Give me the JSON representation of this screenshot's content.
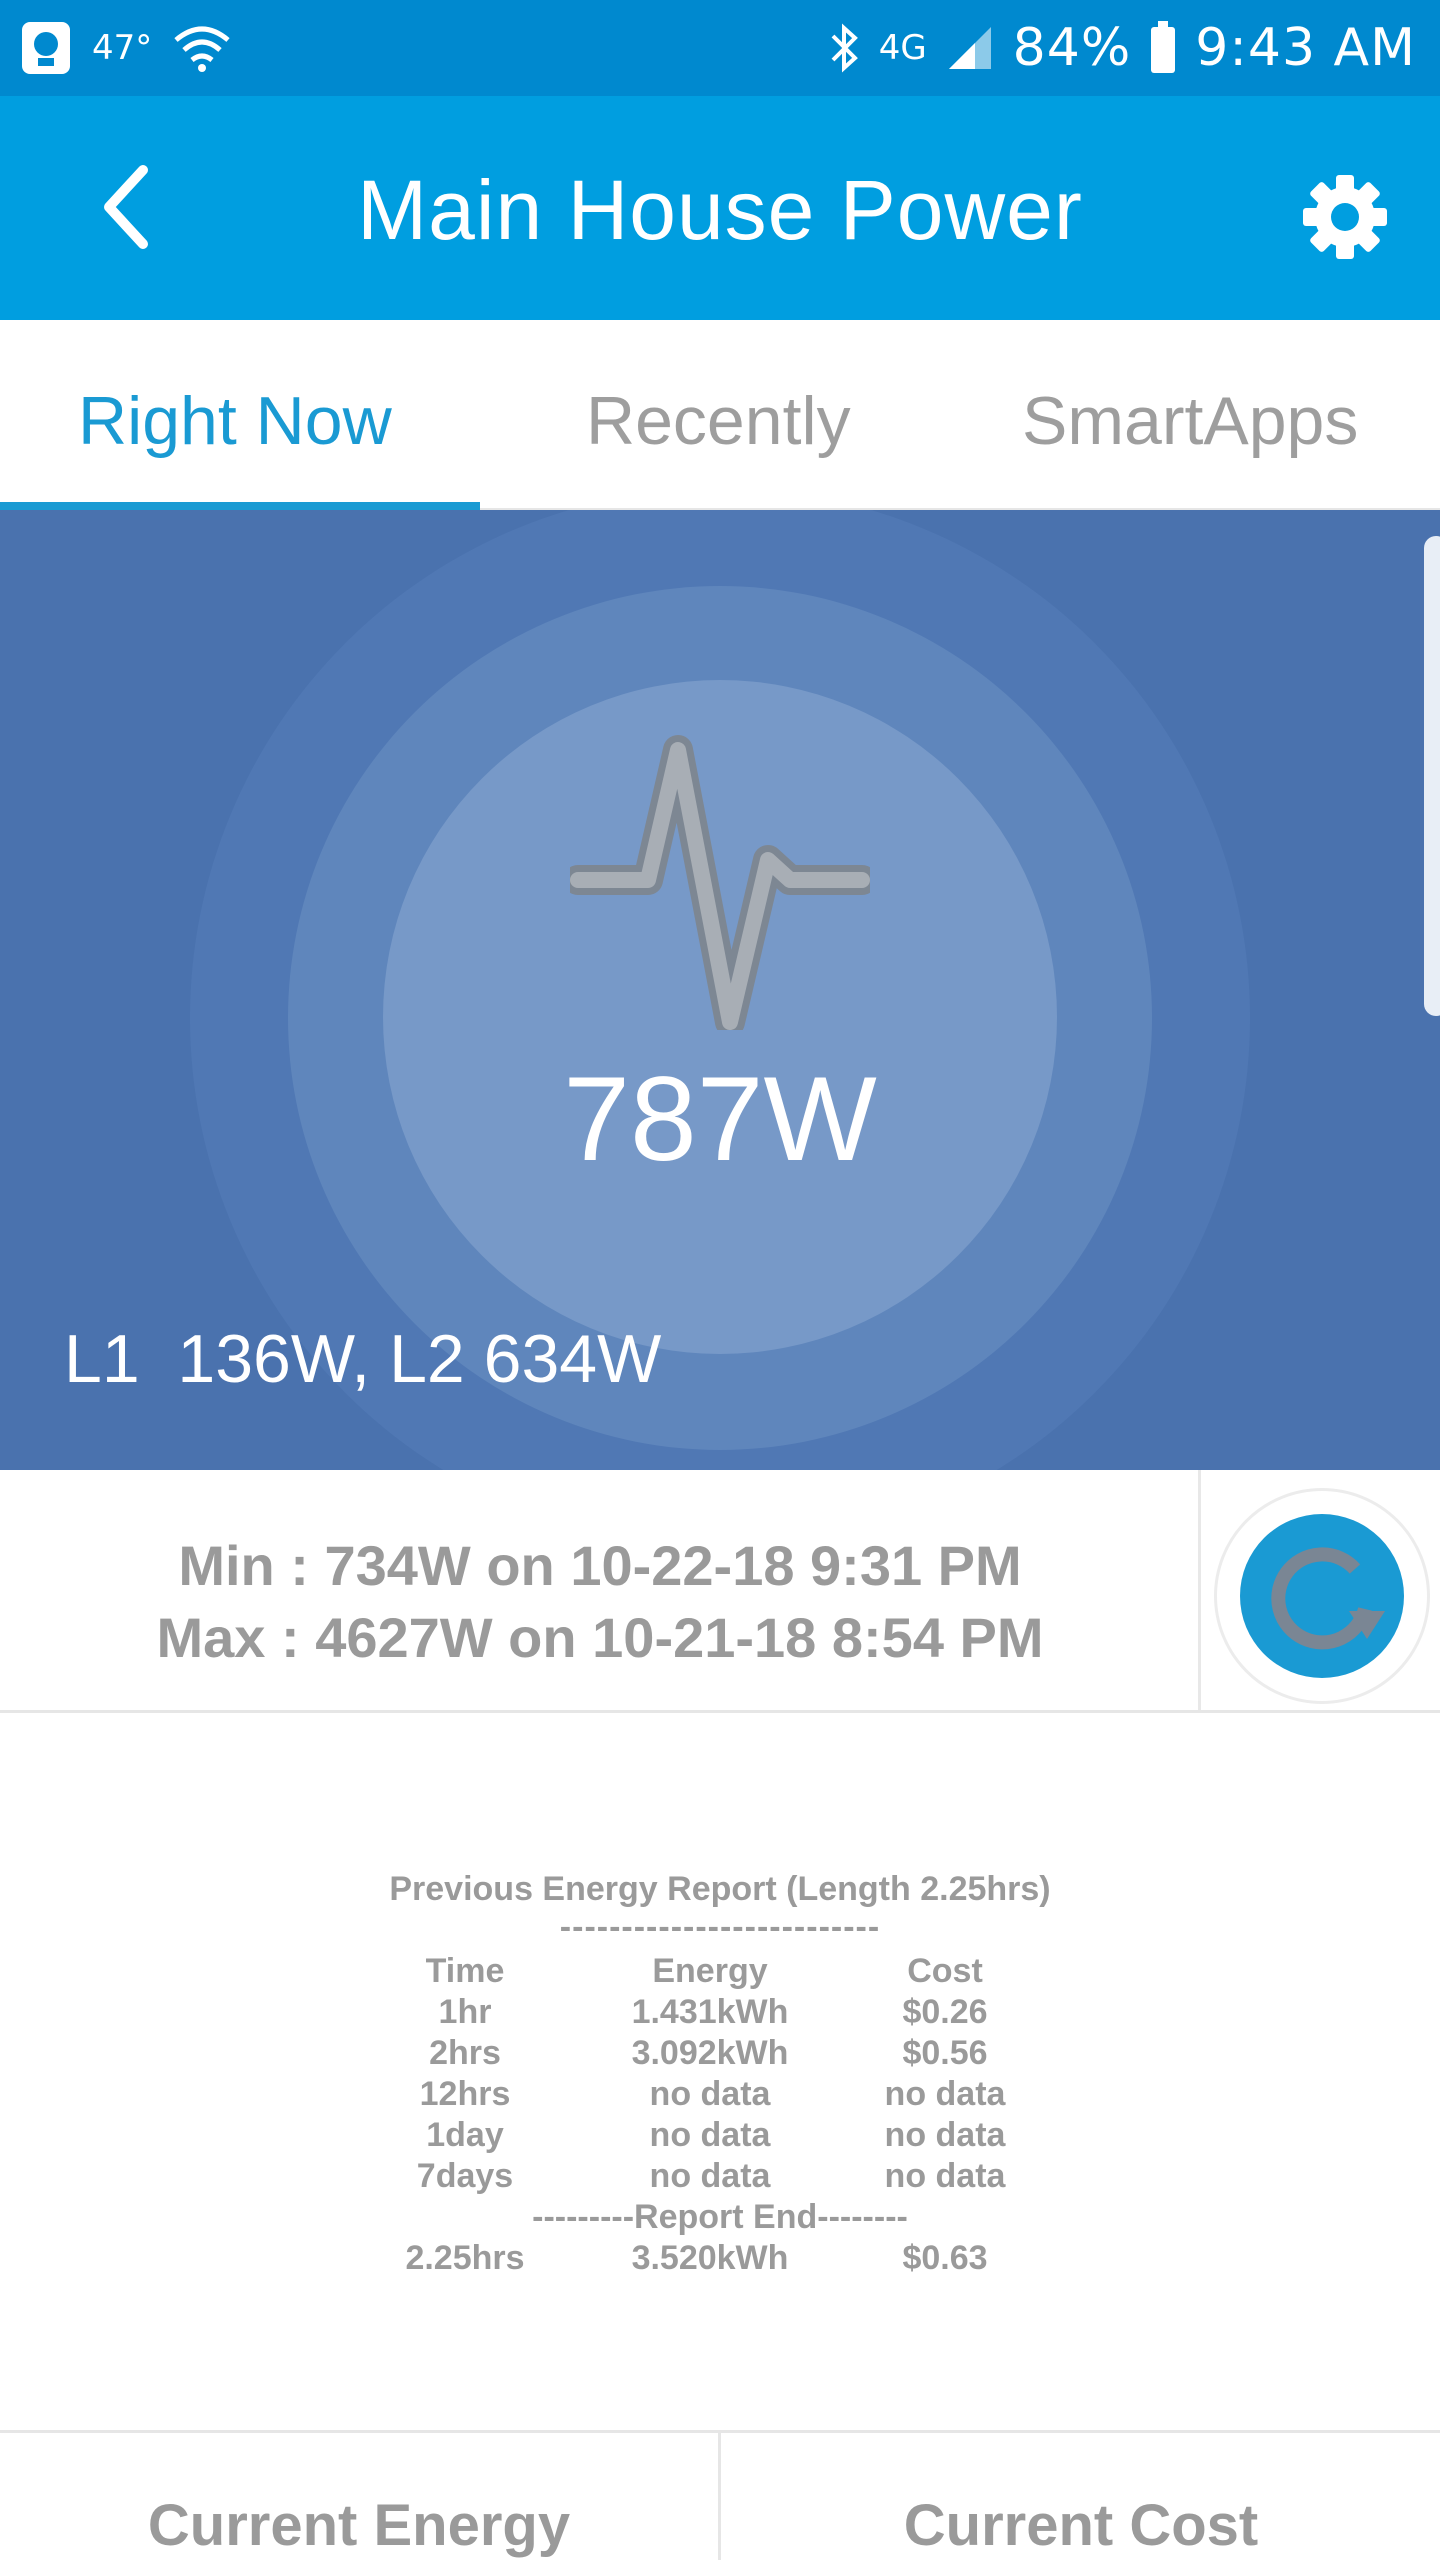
{
  "status_bar": {
    "temperature": "47°",
    "network": "4G",
    "battery": "84%",
    "time": "9:43 AM"
  },
  "header": {
    "title": "Main House Power",
    "back_icon": "chevron-left-icon",
    "settings_icon": "gear-icon"
  },
  "tabs": [
    {
      "label": "Right Now",
      "active": true
    },
    {
      "label": "Recently",
      "active": false
    },
    {
      "label": "SmartApps",
      "active": false
    }
  ],
  "hero": {
    "value": "787W",
    "lines": "L1  136W, L2 634W",
    "icon": "pulse-icon"
  },
  "minmax": {
    "min": "Min : 734W on 10-22-18 9:31 PM",
    "max": "Max : 4627W on 10-21-18 8:54 PM",
    "refresh_icon": "refresh-icon"
  },
  "report": {
    "title": "Previous Energy Report (Length 2.25hrs)",
    "separator": "--------------------------",
    "headers": [
      "Time",
      "Energy",
      "Cost"
    ],
    "rows": [
      [
        "1hr",
        "1.431kWh",
        "$0.26"
      ],
      [
        "2hrs",
        "3.092kWh",
        "$0.56"
      ],
      [
        "12hrs",
        "no data",
        "no data"
      ],
      [
        "1day",
        "no data",
        "no data"
      ],
      [
        "7days",
        "no data",
        "no data"
      ]
    ],
    "end_label": "---------Report End--------",
    "total": [
      "2.25hrs",
      "3.520kWh",
      "$0.63"
    ]
  },
  "bottom": {
    "left_label": "Current Energy",
    "right_label": "Current Cost"
  },
  "colors": {
    "status_bar": "#0089cf",
    "app_bar": "#009ee0",
    "accent": "#1a9ad3",
    "hero_bg": "#4a72ae"
  }
}
